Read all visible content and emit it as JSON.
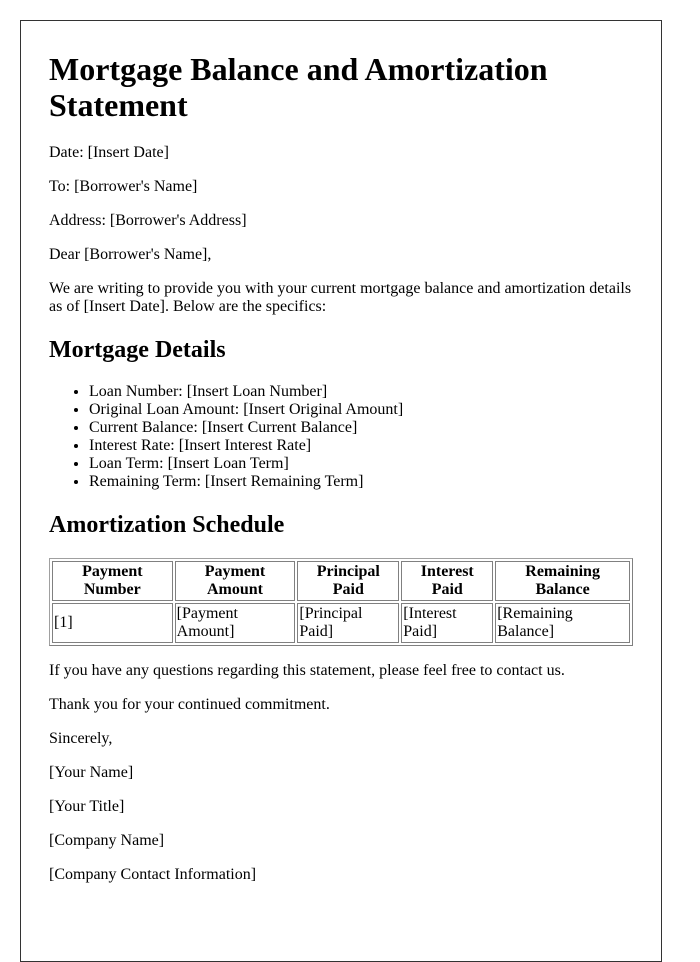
{
  "document": {
    "title": "Mortgage Balance and Amortization Statement",
    "header_fields": [
      "Date: [Insert Date]",
      "To: [Borrower's Name]",
      "Address: [Borrower's Address]"
    ],
    "salutation": "Dear [Borrower's Name],",
    "intro": "We are writing to provide you with your current mortgage balance and amortization details as of [Insert Date]. Below are the specifics:",
    "mortgage_details": {
      "heading": "Mortgage Details",
      "items": [
        "Loan Number: [Insert Loan Number]",
        "Original Loan Amount: [Insert Original Amount]",
        "Current Balance: [Insert Current Balance]",
        "Interest Rate: [Insert Interest Rate]",
        "Loan Term: [Insert Loan Term]",
        "Remaining Term: [Insert Remaining Term]"
      ]
    },
    "amortization": {
      "heading": "Amortization Schedule",
      "columns": [
        "Payment Number",
        "Payment Amount",
        "Principal Paid",
        "Interest Paid",
        "Remaining Balance"
      ],
      "rows": [
        [
          "[1]",
          "[Payment Amount]",
          "[Principal Paid]",
          "[Interest Paid]",
          "[Remaining Balance]"
        ]
      ]
    },
    "closing_paragraphs": [
      "If you have any questions regarding this statement, please feel free to contact us.",
      "Thank you for your continued commitment."
    ],
    "sign_off": "Sincerely,",
    "signature": [
      "[Your Name]",
      "[Your Title]",
      "[Company Name]",
      "[Company Contact Information]"
    ]
  }
}
